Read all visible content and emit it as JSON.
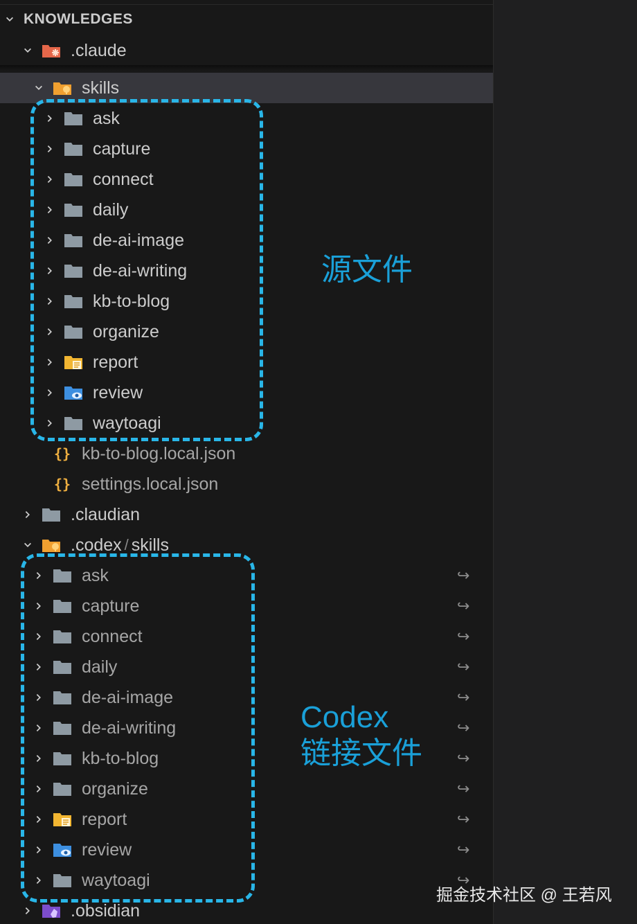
{
  "header": {
    "title": "KNOWLEDGES"
  },
  "tree": {
    "claude": {
      "label": ".claude"
    },
    "skills": {
      "label": "skills"
    },
    "claude_skills": [
      "ask",
      "capture",
      "connect",
      "daily",
      "de-ai-image",
      "de-ai-writing",
      "kb-to-blog",
      "organize",
      "report",
      "review",
      "waytoagi"
    ],
    "claude_files": [
      "kb-to-blog.local.json",
      "settings.local.json"
    ],
    "claudian": {
      "label": ".claudian"
    },
    "codex": {
      "label": ".codex",
      "sub": "skills",
      "sep": "/"
    },
    "codex_skills": [
      "ask",
      "capture",
      "connect",
      "daily",
      "de-ai-image",
      "de-ai-writing",
      "kb-to-blog",
      "organize",
      "report",
      "review",
      "waytoagi"
    ],
    "obsidian": {
      "label": ".obsidian"
    }
  },
  "annotations": {
    "source": "源文件",
    "codex_line1": "Codex",
    "codex_line2": "链接文件"
  },
  "watermark": "掘金技术社区 @ 王若风",
  "symlink_glyph": "↪",
  "colors": {
    "accent": "#29b6e8",
    "selected_row": "#37373d",
    "folder": "#8e9aa3"
  }
}
